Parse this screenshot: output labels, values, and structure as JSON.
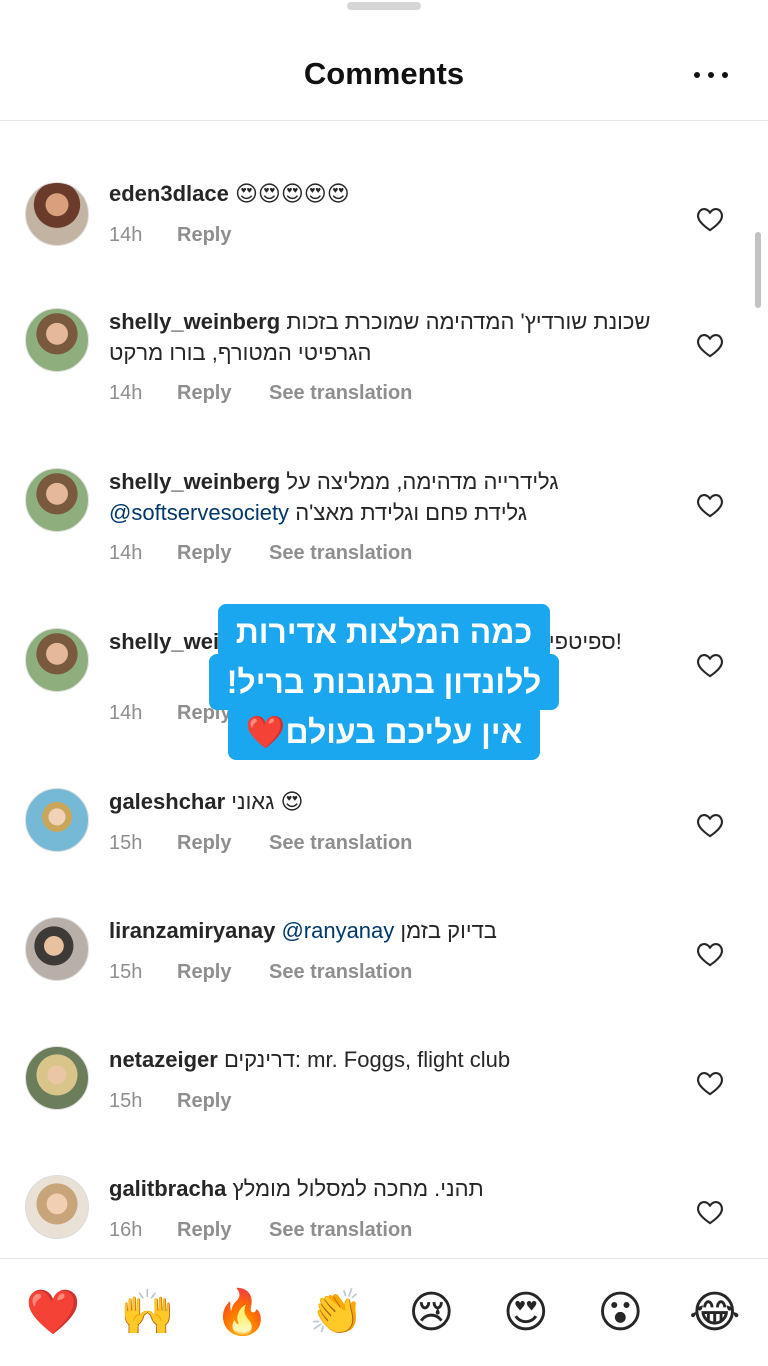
{
  "header": {
    "title": "Comments",
    "more_icon": "more-horizontal-icon"
  },
  "comments": [
    {
      "username": "eden3dlace",
      "text": "😍😍😍😍😍",
      "time": "14h",
      "reply": "Reply",
      "translation": ""
    },
    {
      "username": "shelly_weinberg",
      "text": "שכונת שורדיץ' המדהימה שמוכרת בזכות הגרפיטי המטורף, בורו מרקט",
      "time": "14h",
      "reply": "Reply",
      "translation": "See translation"
    },
    {
      "username": "shelly_weinberg",
      "text": "גלידרייה מדהימה, ממליצה על",
      "mention": "@softservesociety",
      "text2": "גלידת פחם וגלידת מאצ'ה",
      "time": "14h",
      "reply": "Reply",
      "translation": "See translation"
    },
    {
      "username": "shelly_weinberg",
      "text": "ספיטפילדס מרקט מלא דוכנים שווים!",
      "time": "14h",
      "reply": "Reply",
      "translation": ""
    },
    {
      "username": "galeshchar",
      "text": "גאוני 😍",
      "time": "15h",
      "reply": "Reply",
      "translation": "See translation"
    },
    {
      "username": "liranzamiryanay",
      "mention": "@ranyanay",
      "text": "בדיוק בזמן",
      "time": "15h",
      "reply": "Reply",
      "translation": "See translation"
    },
    {
      "username": "netazeiger",
      "text": "דרינקים: mr. Foggs, flight club",
      "time": "15h",
      "reply": "Reply",
      "translation": ""
    },
    {
      "username": "galitbracha",
      "text": "תהני. מחכה למסלול מומלץ",
      "time": "16h",
      "reply": "Reply",
      "translation": "See translation"
    }
  ],
  "overlay": {
    "line1": "כמה המלצות אדירות",
    "line2": "ללונדון בתגובות בריל!",
    "line3": "אין עליכם בעולם❤️"
  },
  "reactions": [
    "❤️",
    "🙌",
    "🔥",
    "👏",
    "😢",
    "😍",
    "😮",
    "😂"
  ],
  "colors": {
    "accent_overlay": "#1ba6f0",
    "mention": "#00376b",
    "meta_gray": "#8e8e8e"
  },
  "icons": {
    "like": "heart-outline-icon"
  }
}
